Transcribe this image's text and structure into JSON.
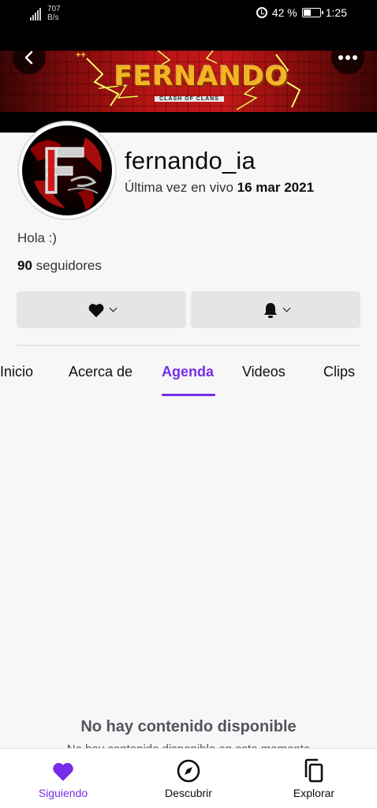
{
  "status_bar": {
    "network_speed_value": "707",
    "network_speed_unit": "B/s",
    "battery_percent": "42 %",
    "battery_level": 0.42,
    "time": "1:25"
  },
  "banner": {
    "title": "FERNANDO",
    "subtitle": "CLASH OF CLANS",
    "decoration": "++"
  },
  "profile": {
    "username": "fernando_ia",
    "last_live_prefix": "Última vez en vivo",
    "last_live_date": "16 mar 2021",
    "bio": "Hola :)",
    "followers_count": "90",
    "followers_label": "seguidores",
    "avatar_letter": "F"
  },
  "tabs": [
    {
      "label": "Inicio",
      "active": false
    },
    {
      "label": "Acerca de",
      "active": false
    },
    {
      "label": "Agenda",
      "active": true
    },
    {
      "label": "Videos",
      "active": false
    },
    {
      "label": "Clips",
      "active": false
    }
  ],
  "empty_state": {
    "title": "No hay contenido disponible",
    "subtitle": "No hay contenido disponible en este momento"
  },
  "bottom_nav": [
    {
      "label": "Siguiendo",
      "icon": "heart-icon",
      "active": true
    },
    {
      "label": "Descubrir",
      "icon": "compass-icon",
      "active": false
    },
    {
      "label": "Explorar",
      "icon": "copy-icon",
      "active": false
    }
  ],
  "colors": {
    "accent": "#772ce8",
    "text": "#0e0e10",
    "background": "#f7f7f8",
    "button_bg": "#e5e5e7"
  }
}
